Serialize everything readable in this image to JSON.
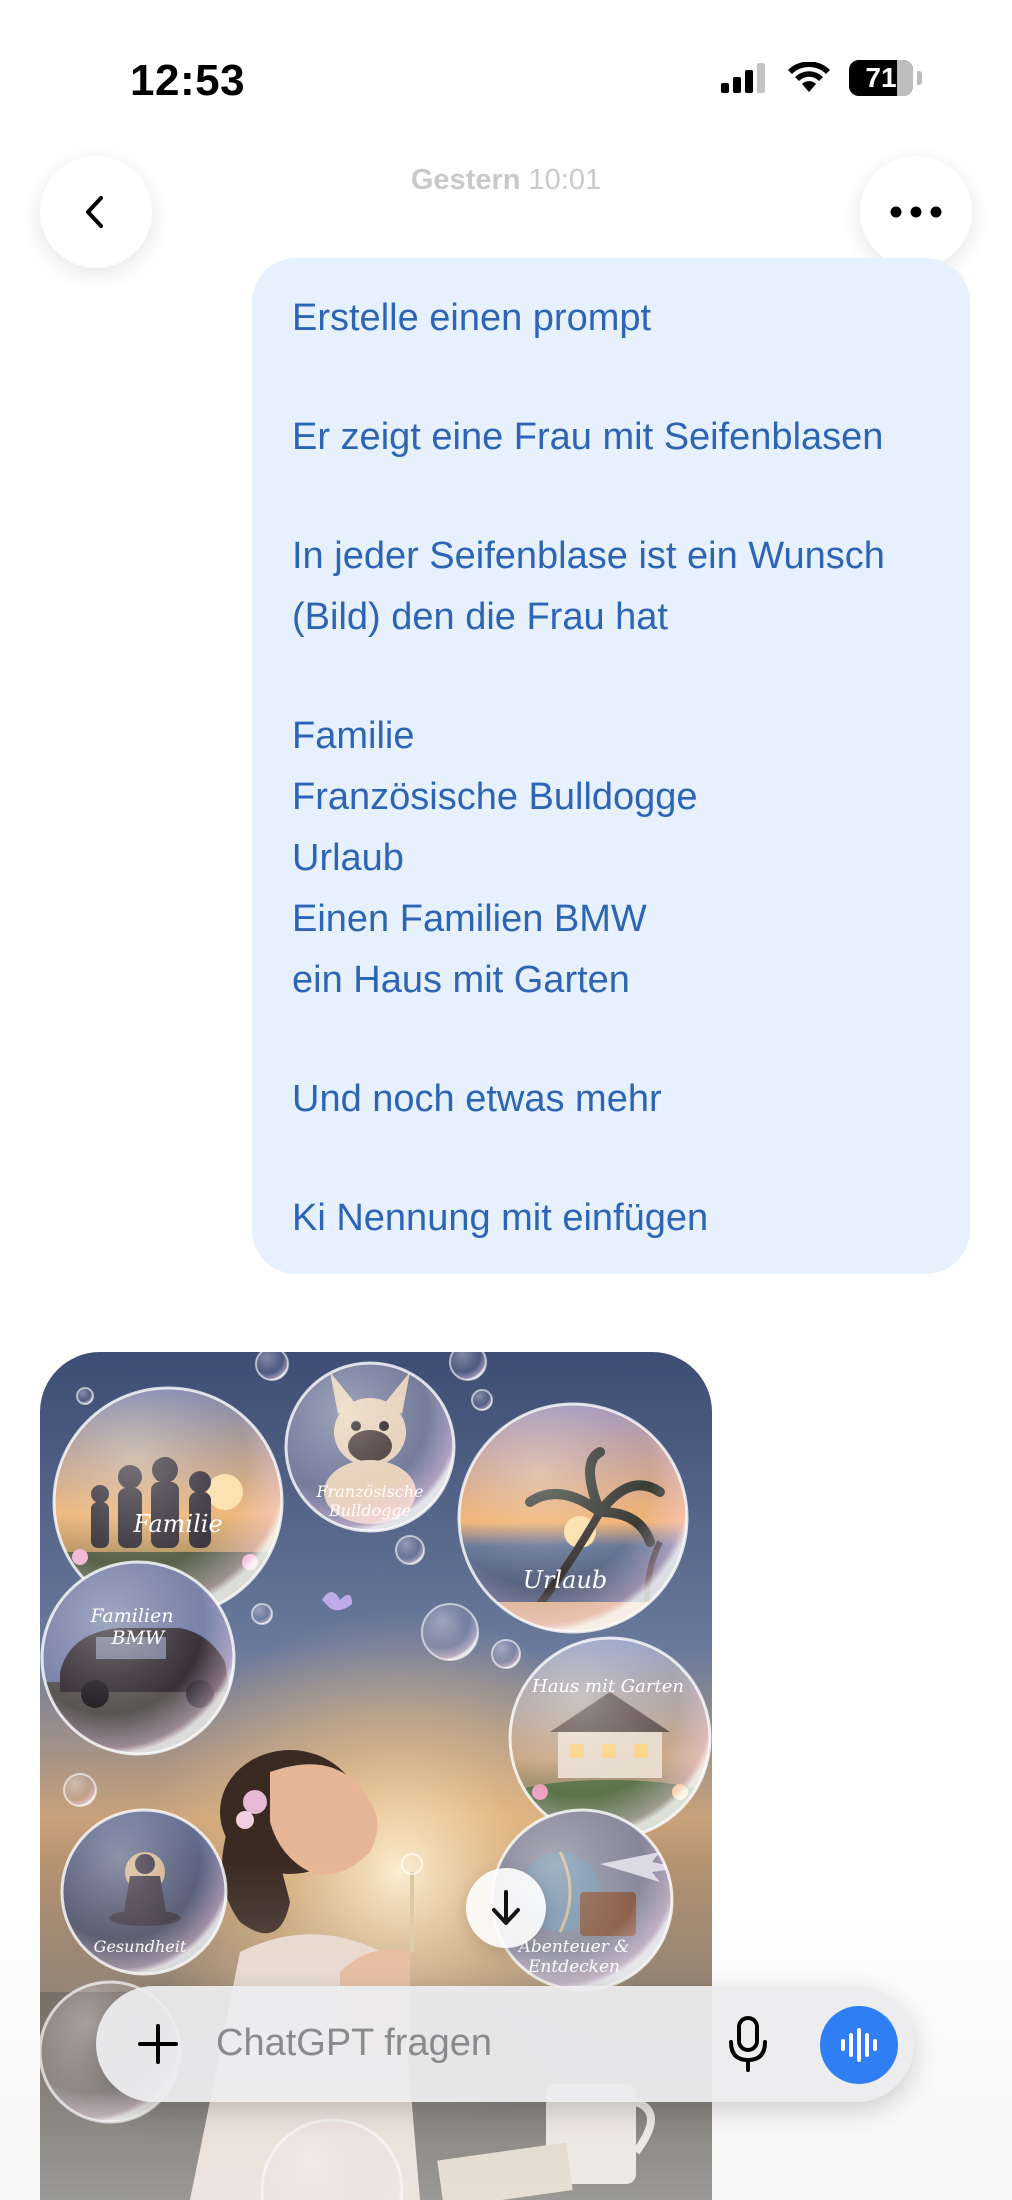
{
  "status_bar": {
    "time": "12:53",
    "battery": "71"
  },
  "header": {
    "timestamp_day": "Gestern",
    "timestamp_time": "10:01",
    "back_icon": "chevron-left-icon",
    "more_icon": "ellipsis-icon"
  },
  "message": {
    "lines": [
      "Erstelle einen prompt",
      "",
      "Er zeigt eine Frau mit Seifenblasen",
      "",
      "In jeder Seifenblase ist ein Wunsch",
      "(Bild) den die Frau hat",
      "",
      "Familie",
      "Französische Bulldogge",
      "Urlaub",
      "Einen Familien BMW",
      "ein Haus mit Garten",
      "",
      "Und noch etwas mehr",
      "",
      "Ki Nennung mit einfügen"
    ]
  },
  "image": {
    "bubbles": {
      "familie": "Familie",
      "bulldogge_1": "Französische",
      "bulldogge_2": "Bulldogge",
      "urlaub": "Urlaub",
      "bmw_1": "Familien",
      "bmw_2": "BMW",
      "haus": "Haus mit Garten",
      "gesundheit": "Gesundheit",
      "abenteuer_1": "Abenteuer &",
      "abenteuer_2": "Entdecken"
    }
  },
  "composer": {
    "placeholder": "ChatGPT fragen"
  },
  "colors": {
    "bubble_bg": "#e6f1fd",
    "bubble_text": "#2d65b4",
    "voice_button": "#2f7ef3"
  }
}
